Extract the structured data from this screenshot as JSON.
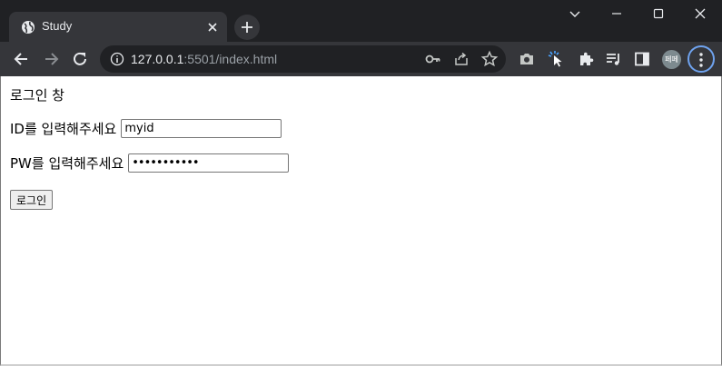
{
  "browser": {
    "tab": {
      "title": "Study"
    },
    "address": {
      "host": "127.0.0.1",
      "path": ":5501/index.html"
    },
    "profile": {
      "initials": "페페"
    }
  },
  "page": {
    "heading": "로그인 창",
    "id_field": {
      "label": "ID를 입력해주세요",
      "value": "myid"
    },
    "pw_field": {
      "label": "PW를 입력해주세요",
      "value": "•••••••••••"
    },
    "login_button": {
      "label": "로그인"
    }
  },
  "icons": [
    "globe-icon",
    "close-icon",
    "plus-icon",
    "chevron-down-icon",
    "minimize-icon",
    "maximize-icon",
    "window-close-icon",
    "back-icon",
    "forward-icon",
    "reload-icon",
    "info-icon",
    "key-icon",
    "share-icon",
    "star-icon",
    "camera-icon",
    "cursor-icon",
    "extensions-icon",
    "reading-list-icon",
    "side-panel-icon",
    "more-icon"
  ],
  "colors": {
    "chrome_dark": "#202124",
    "chrome_toolbar": "#35363a",
    "focus_ring": "#6fa3ef"
  }
}
